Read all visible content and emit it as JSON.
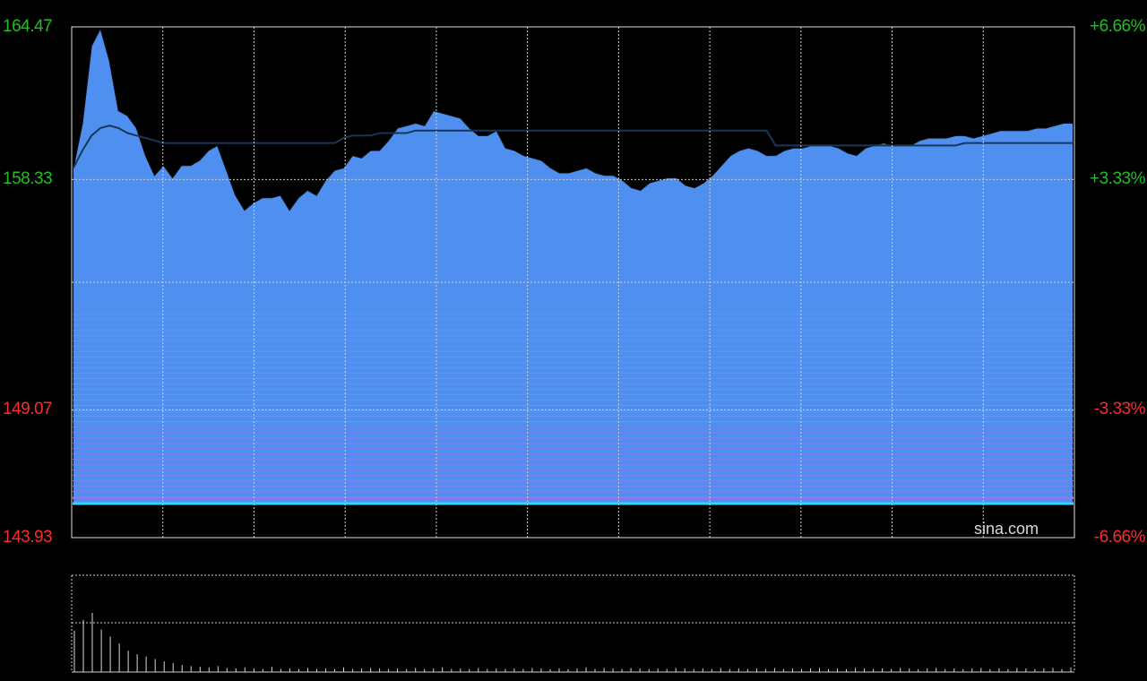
{
  "chart_data": [
    {
      "type": "area",
      "watermark": "sina.com",
      "colors": {
        "background": "#000000",
        "fill": "#4f8ff0",
        "price_line": "#0d0d0d",
        "avg_line": "#17365a",
        "grid": "#d0d0d0",
        "base_line": "#33d6ff",
        "up": "#1fbf1f",
        "down": "#ff2a2a"
      },
      "ylim": [
        143.93,
        164.47
      ],
      "grid": true,
      "y_ticks_left": [
        {
          "label": "164.47",
          "value": 164.47,
          "color": "#1fbf1f"
        },
        {
          "label": "158.33",
          "value": 158.33,
          "color": "#1fbf1f"
        },
        {
          "label": "149.07",
          "value": 149.07,
          "color": "#ff2a2a"
        },
        {
          "label": "143.93",
          "value": 143.93,
          "color": "#ff2a2a"
        }
      ],
      "y_ticks_right": [
        {
          "label": "+6.66%",
          "value": 164.47,
          "color": "#1fbf1f"
        },
        {
          "label": "+3.33%",
          "value": 158.33,
          "color": "#1fbf1f"
        },
        {
          "label": "-3.33%",
          "value": 149.07,
          "color": "#ff2a2a"
        },
        {
          "label": "-6.66%",
          "value": 143.93,
          "color": "#ff2a2a"
        }
      ],
      "x_divisions": 11,
      "series": [
        {
          "values": [
            158.8,
            160.6,
            163.7,
            164.4,
            163.1,
            161.1,
            160.9,
            160.4,
            159.3,
            158.5,
            158.9,
            158.4,
            158.9,
            158.9,
            159.1,
            159.5,
            159.7,
            158.7,
            157.7,
            157.1,
            157.4,
            157.6,
            157.6,
            157.7,
            157.1,
            157.6,
            157.9,
            157.7,
            158.3,
            158.7,
            158.8,
            159.3,
            159.2,
            159.5,
            159.5,
            159.9,
            160.4,
            160.5,
            160.6,
            160.5,
            161.1,
            161.0,
            160.9,
            160.8,
            160.4,
            160.1,
            160.1,
            160.3,
            159.6,
            159.5,
            159.3,
            159.2,
            159.1,
            158.8,
            158.6,
            158.6,
            158.7,
            158.8,
            158.6,
            158.5,
            158.5,
            158.3,
            158.0,
            157.9,
            158.2,
            158.3,
            158.4,
            158.4,
            158.1,
            158.0,
            158.2,
            158.5,
            158.9,
            159.3,
            159.5,
            159.6,
            159.5,
            159.3,
            159.3,
            159.5,
            159.6,
            159.6,
            159.7,
            159.7,
            159.7,
            159.6,
            159.4,
            159.3,
            159.6,
            159.7,
            159.8,
            159.7,
            159.7,
            159.7,
            159.9,
            160.0,
            160.0,
            160.0,
            160.1,
            160.1,
            160.0,
            160.1,
            160.2,
            160.3,
            160.3,
            160.3,
            160.3,
            160.4,
            160.4,
            160.5,
            160.6,
            160.6
          ],
          "avg_values": [
            158.8,
            159.5,
            160.1,
            160.4,
            160.5,
            160.4,
            160.2,
            160.1,
            160.0,
            159.9,
            159.8,
            159.8,
            159.8,
            159.8,
            159.8,
            159.8,
            159.8,
            159.8,
            159.8,
            159.8,
            159.8,
            159.8,
            159.8,
            159.8,
            159.8,
            159.8,
            159.8,
            159.8,
            159.8,
            159.8,
            160.0,
            160.1,
            160.1,
            160.1,
            160.2,
            160.2,
            160.2,
            160.2,
            160.3,
            160.3,
            160.3,
            160.3,
            160.3,
            160.3,
            160.3,
            160.3,
            160.3,
            160.3,
            160.3,
            160.3,
            160.3,
            160.3,
            160.3,
            160.3,
            160.3,
            160.3,
            160.3,
            160.3,
            160.3,
            160.3,
            160.3,
            160.3,
            160.3,
            160.3,
            160.3,
            160.3,
            160.3,
            160.3,
            160.3,
            160.3,
            160.3,
            160.3,
            160.3,
            160.3,
            160.3,
            160.3,
            160.3,
            160.3,
            159.7,
            159.7,
            159.7,
            159.7,
            159.7,
            159.7,
            159.7,
            159.7,
            159.7,
            159.7,
            159.7,
            159.7,
            159.7,
            159.7,
            159.7,
            159.7,
            159.7,
            159.7,
            159.7,
            159.7,
            159.7,
            159.8,
            159.8,
            159.8,
            159.8,
            159.8,
            159.8,
            159.8,
            159.8,
            159.8,
            159.8,
            159.8,
            159.8,
            159.8
          ]
        }
      ]
    },
    {
      "type": "bar",
      "grid": true,
      "x_divisions": 11,
      "colors": {
        "bar": "#d8d8d8",
        "grid": "#d0d0d0"
      },
      "values": [
        70,
        88,
        100,
        72,
        60,
        48,
        36,
        30,
        26,
        22,
        18,
        15,
        12,
        10,
        9,
        8,
        10,
        7,
        6,
        8,
        6,
        5,
        9,
        5,
        6,
        5,
        7,
        5,
        6,
        5,
        8,
        5,
        6,
        7,
        6,
        5,
        6,
        5,
        7,
        5,
        6,
        8,
        5,
        6,
        5,
        7,
        5,
        6,
        5,
        6,
        5,
        7,
        6,
        5,
        6,
        5,
        6,
        8,
        5,
        7,
        6,
        5,
        7,
        6,
        5,
        6,
        5,
        7,
        6,
        5,
        6,
        5,
        7,
        5,
        6,
        5,
        6,
        5,
        7,
        5,
        6,
        5,
        6,
        7,
        5,
        6,
        5,
        7,
        6,
        5,
        6,
        5,
        7,
        6,
        5,
        6,
        7,
        5,
        6,
        5,
        6,
        7,
        5,
        6,
        5,
        7,
        6,
        5,
        6,
        7,
        5,
        8
      ]
    }
  ]
}
